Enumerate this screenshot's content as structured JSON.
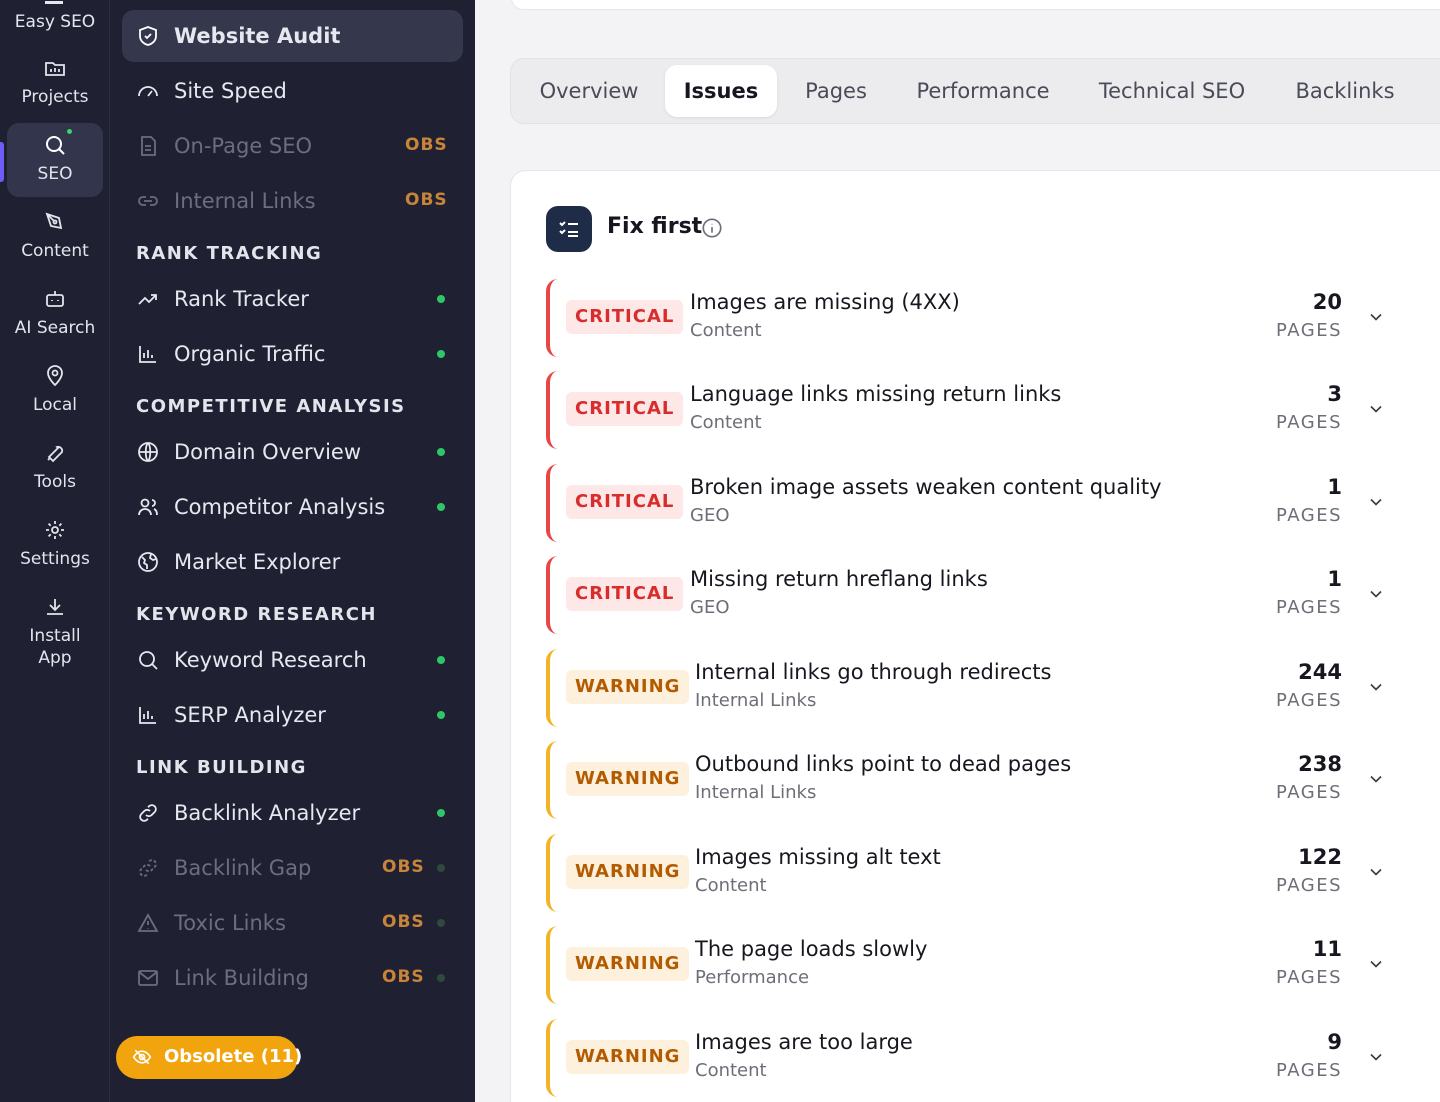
{
  "rail": {
    "brand": "Easy SEO",
    "items": [
      {
        "label": "Projects",
        "icon": "projects-icon"
      },
      {
        "label": "SEO",
        "icon": "search-icon"
      },
      {
        "label": "Content",
        "icon": "pen-icon"
      },
      {
        "label": "AI Search",
        "icon": "robot-icon"
      },
      {
        "label": "Local",
        "icon": "location-pin-icon"
      },
      {
        "label": "Tools",
        "icon": "wrench-icon"
      },
      {
        "label": "Settings",
        "icon": "gear-icon"
      },
      {
        "label": "Install App",
        "icon": "download-icon"
      }
    ]
  },
  "sidebar": {
    "items": [
      {
        "label": "Website Audit",
        "icon": "shield-icon"
      },
      {
        "label": "Site Speed",
        "icon": "speedometer-icon"
      },
      {
        "label": "On-Page SEO",
        "icon": "document-icon",
        "badge": "OBS"
      },
      {
        "label": "Internal Links",
        "icon": "link-icon",
        "badge": "OBS"
      }
    ],
    "sections": [
      {
        "title": "RANK TRACKING",
        "items": [
          {
            "label": "Rank Tracker",
            "icon": "trend-up-icon"
          },
          {
            "label": "Organic Traffic",
            "icon": "bar-chart-icon"
          }
        ]
      },
      {
        "title": "COMPETITIVE ANALYSIS",
        "items": [
          {
            "label": "Domain Overview",
            "icon": "globe-icon"
          },
          {
            "label": "Competitor Analysis",
            "icon": "users-icon"
          },
          {
            "label": "Market Explorer",
            "icon": "world-icon"
          }
        ]
      },
      {
        "title": "KEYWORD RESEARCH",
        "items": [
          {
            "label": "Keyword Research",
            "icon": "search-icon"
          },
          {
            "label": "SERP Analyzer",
            "icon": "bar-chart-icon"
          }
        ]
      },
      {
        "title": "LINK BUILDING",
        "items": [
          {
            "label": "Backlink Analyzer",
            "icon": "link-icon"
          },
          {
            "label": "Backlink Gap",
            "icon": "broken-link-icon",
            "badge": "OBS"
          },
          {
            "label": "Toxic Links",
            "icon": "warning-icon",
            "badge": "OBS"
          },
          {
            "label": "Link Building",
            "icon": "mail-icon",
            "badge": "OBS"
          }
        ]
      }
    ],
    "obsolete_button": "Obsolete (11)"
  },
  "tabs": [
    "Overview",
    "Issues",
    "Pages",
    "Performance",
    "Technical SEO",
    "Backlinks"
  ],
  "active_tab": "Issues",
  "panel": {
    "title": "Fix first",
    "issues": [
      {
        "severity": "CRITICAL",
        "title": "Images are missing (4XX)",
        "category": "Content",
        "count": "20",
        "unit": "PAGES"
      },
      {
        "severity": "CRITICAL",
        "title": "Language links missing return links",
        "category": "Content",
        "count": "3",
        "unit": "PAGES"
      },
      {
        "severity": "CRITICAL",
        "title": "Broken image assets weaken content quality",
        "category": "GEO",
        "count": "1",
        "unit": "PAGES"
      },
      {
        "severity": "CRITICAL",
        "title": "Missing return hreflang links",
        "category": "GEO",
        "count": "1",
        "unit": "PAGES"
      },
      {
        "severity": "WARNING",
        "title": "Internal links go through redirects",
        "category": "Internal Links",
        "count": "244",
        "unit": "PAGES"
      },
      {
        "severity": "WARNING",
        "title": "Outbound links point to dead pages",
        "category": "Internal Links",
        "count": "238",
        "unit": "PAGES"
      },
      {
        "severity": "WARNING",
        "title": "Images missing alt text",
        "category": "Content",
        "count": "122",
        "unit": "PAGES"
      },
      {
        "severity": "WARNING",
        "title": "The page loads slowly",
        "category": "Performance",
        "count": "11",
        "unit": "PAGES"
      },
      {
        "severity": "WARNING",
        "title": "Images are too large",
        "category": "Content",
        "count": "9",
        "unit": "PAGES"
      }
    ]
  },
  "colors": {
    "sidebar_bg": "#1f2133",
    "critical": "#d92c2c",
    "warning": "#b35b00",
    "obsolete_button": "#f2a40f",
    "active_dot": "#2ec768"
  }
}
